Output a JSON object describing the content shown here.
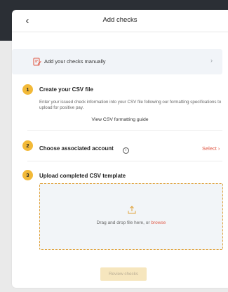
{
  "header": {
    "back_glyph": "‹",
    "title": "Add checks"
  },
  "manual": {
    "icon": "edit-document-icon",
    "label": "Add your checks manually",
    "chevron": "›"
  },
  "steps": [
    {
      "number": "1",
      "title": "Create your CSV file",
      "description": "Enter your issued check information into your CSV file following our formatting specifications to upload for positive pay.",
      "link": "View CSV formatting guide"
    },
    {
      "number": "2",
      "title": "Choose associated account",
      "info_glyph": "i",
      "action": "Select ›"
    },
    {
      "number": "3",
      "title": "Upload completed CSV template",
      "drop_text": "Drag and drop file here, or ",
      "browse": "browse"
    }
  ],
  "review_button": "Review checks",
  "colors": {
    "accent_badge": "#f2b938",
    "link_red": "#e05a47",
    "dropzone_border": "#e0a23a",
    "button_disabled_bg": "#f6e6be"
  }
}
